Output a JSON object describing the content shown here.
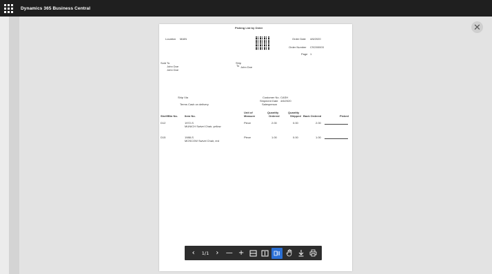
{
  "app": {
    "title": "Dynamics 365 Business Central"
  },
  "report": {
    "title": "Picking List by Order",
    "location_label": "Location",
    "location_value": "MAIN",
    "order_date_label": "Order Date",
    "order_date_value": "4/6/2020",
    "order_number_label": "Order Number",
    "order_number_value": "CSO00003",
    "page_label": "Page",
    "page_value": "1",
    "sold_to_label": "Sold To",
    "sold_to_line1": "John Doe",
    "sold_to_line2": "John Doe",
    "ship_label": "Ship",
    "ship_to_label": "To",
    "ship_to_value": "John Doe",
    "ship_via_label": "Ship Via",
    "terms_label": "Terms",
    "terms_value": "Cash on delivery",
    "customer_no_label": "Customer No.",
    "customer_no_value": "CASH",
    "shipment_date_label": "Shipment Date",
    "shipment_date_value": "4/6/2020",
    "salesperson_label": "Salesperson",
    "columns": {
      "shelf": "Shelf/Bin No.",
      "item": "Item No.",
      "uom_1": "Unit of",
      "uom_2": "Measure",
      "qty_ordered_1": "Quantity",
      "qty_ordered_2": "Ordered",
      "qty_shipped_1": "Quantity",
      "qty_shipped_2": "Shipped",
      "back_ordered": "Back Ordered",
      "picked": "Picked"
    },
    "rows": [
      {
        "shelf": "D12",
        "item_no": "1972-S",
        "description": "MUNICH Swivel Chair, yellow",
        "uom": "Piece",
        "ordered": "2.00",
        "shipped": "0.00",
        "back": "2.00"
      },
      {
        "shelf": "D15",
        "item_no": "1988-S",
        "description": "MOSCOW Swivel Chair, red",
        "uom": "Piece",
        "ordered": "1.00",
        "shipped": "0.00",
        "back": "1.00"
      }
    ]
  },
  "toolbar": {
    "prev_icon": "chevron-left-icon",
    "page_indicator": "1/1",
    "next_icon": "chevron-right-icon",
    "zoom_out_icon": "minus-icon",
    "zoom_in_icon": "plus-icon",
    "fit_width_icon": "fit-width-icon",
    "fit_page_icon": "fit-page-icon",
    "read_mode_icon": "view-mode-icon",
    "pan_icon": "hand-icon",
    "download_icon": "download-icon",
    "print_icon": "print-icon",
    "active_color": "#2a6fd4"
  },
  "close_icon": "close-icon"
}
